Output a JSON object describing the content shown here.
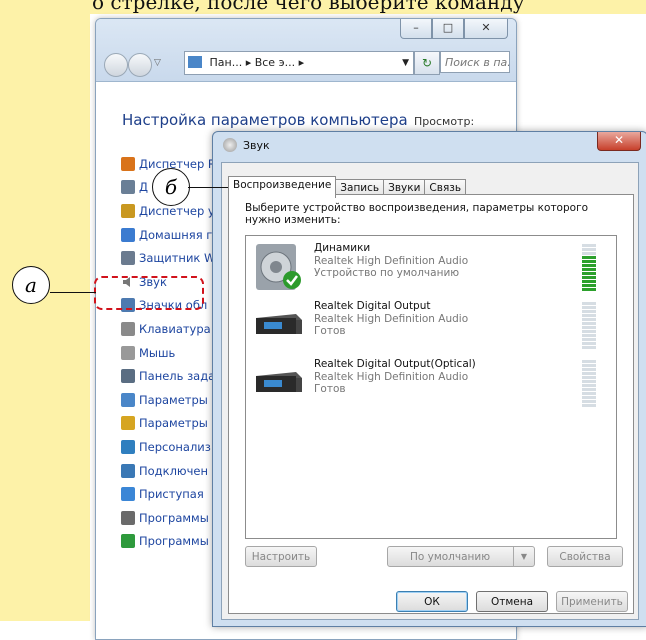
{
  "top_text": "о стрелке, после чего выберите команду",
  "control_panel": {
    "window_buttons": {
      "minimize": "–",
      "maximize": "□",
      "close": "✕"
    },
    "address": "Пан... ▸ Все э... ▸",
    "search_placeholder": "Поиск в па.",
    "heading": "Настройка параметров компьютера",
    "view_label": "Просмотр:",
    "items": [
      {
        "label": "Диспетчер R",
        "icon": "realtek-icon",
        "color": "#d9731a"
      },
      {
        "label": "Д",
        "icon": "devices-icon",
        "color": "#6a7f96"
      },
      {
        "label": "Диспетчер у",
        "icon": "device-manager-icon",
        "color": "#c99820"
      },
      {
        "label": "Домашняя г",
        "icon": "homegroup-icon",
        "color": "#3b7bd0"
      },
      {
        "label": "Защитник W",
        "icon": "defender-icon",
        "color": "#6b7b8f"
      },
      {
        "label": "Звук",
        "icon": "speaker-icon",
        "color": "#777"
      },
      {
        "label": "Значки обл",
        "icon": "notification-icon",
        "color": "#4d7ab0"
      },
      {
        "label": "Клавиатура",
        "icon": "keyboard-icon",
        "color": "#8a8a8a"
      },
      {
        "label": "Мышь",
        "icon": "mouse-icon",
        "color": "#999"
      },
      {
        "label": "Панель зада",
        "icon": "taskbar-icon",
        "color": "#5a6d82"
      },
      {
        "label": "Параметры",
        "icon": "user-icon",
        "color": "#4a86c8"
      },
      {
        "label": "Параметры",
        "icon": "folder-options-icon",
        "color": "#d6a521"
      },
      {
        "label": "Персонализ",
        "icon": "personalization-icon",
        "color": "#2f7fbf"
      },
      {
        "label": "Подключен",
        "icon": "remote-icon",
        "color": "#3a78b5"
      },
      {
        "label": "Приступая",
        "icon": "getting-started-icon",
        "color": "#3b86d6"
      },
      {
        "label": "Программы",
        "icon": "programs-icon",
        "color": "#6a6a6a"
      },
      {
        "label": "Программы",
        "icon": "default-programs-icon",
        "color": "#2e9a3c"
      }
    ]
  },
  "callouts": {
    "a": "а",
    "b": "б"
  },
  "dialog": {
    "title": "Звук",
    "close": "✕",
    "tabs": [
      "Воспроизведение",
      "Запись",
      "Звуки",
      "Связь"
    ],
    "instruction": "Выберите устройство воспроизведения, параметры которого нужно изменить:",
    "devices": [
      {
        "name": "Динамики",
        "description": "Realtek High Definition Audio",
        "status": "Устройство по умолчанию",
        "level": 0.78,
        "default": true
      },
      {
        "name": "Realtek Digital Output",
        "description": "Realtek High Definition Audio",
        "status": "Готов",
        "level": 0,
        "default": false
      },
      {
        "name": "Realtek Digital Output(Optical)",
        "description": "Realtek High Definition Audio",
        "status": "Готов",
        "level": 0,
        "default": false
      }
    ],
    "buttons": {
      "configure": "Настроить",
      "set_default": "По умолчанию",
      "properties": "Свойства",
      "ok": "ОК",
      "cancel": "Отмена",
      "apply": "Применить"
    }
  }
}
